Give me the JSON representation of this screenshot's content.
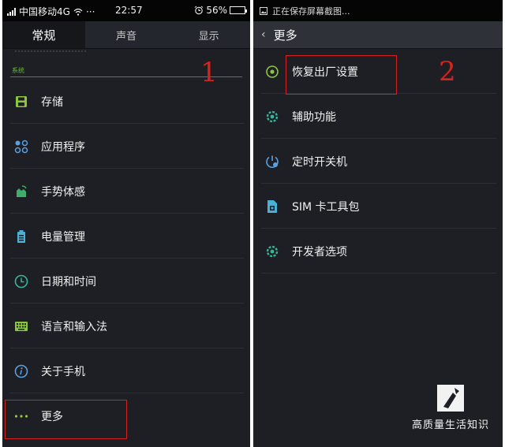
{
  "left_screen": {
    "status_bar": {
      "carrier": "中国移动4G",
      "dots": "···",
      "time": "22:57",
      "battery_percent": "56%",
      "battery_level": 0.56
    },
    "tabs": [
      {
        "label": "常规",
        "active": true
      },
      {
        "label": "声音",
        "active": false
      },
      {
        "label": "显示",
        "active": false
      }
    ],
    "section_label": "系统",
    "items": [
      {
        "label": "存储",
        "icon": "sd-card-icon"
      },
      {
        "label": "应用程序",
        "icon": "apps-grid-icon"
      },
      {
        "label": "手势体感",
        "icon": "hand-gesture-icon"
      },
      {
        "label": "电量管理",
        "icon": "battery-icon"
      },
      {
        "label": "日期和时间",
        "icon": "clock-icon"
      },
      {
        "label": "语言和输入法",
        "icon": "keyboard-icon"
      },
      {
        "label": "关于手机",
        "icon": "info-icon"
      },
      {
        "label": "更多",
        "icon": "more-dots-icon"
      }
    ],
    "annotation_number": "1"
  },
  "right_screen": {
    "notification_text": "正在保存屏幕截图...",
    "header_title": "更多",
    "items": [
      {
        "label": "恢复出厂设置",
        "icon": "restore-icon"
      },
      {
        "label": "辅助功能",
        "icon": "accessibility-gear-icon"
      },
      {
        "label": "定时开关机",
        "icon": "timer-power-icon"
      },
      {
        "label": "SIM 卡工具包",
        "icon": "sim-card-icon"
      },
      {
        "label": "开发者选项",
        "icon": "developer-gear-icon"
      }
    ],
    "annotation_number": "2"
  },
  "watermark": {
    "text": "高质量生活知识"
  },
  "colors": {
    "accent_green": "#6dbb3e",
    "highlight_red": "#d21f1f",
    "background": "#1d1f24"
  }
}
